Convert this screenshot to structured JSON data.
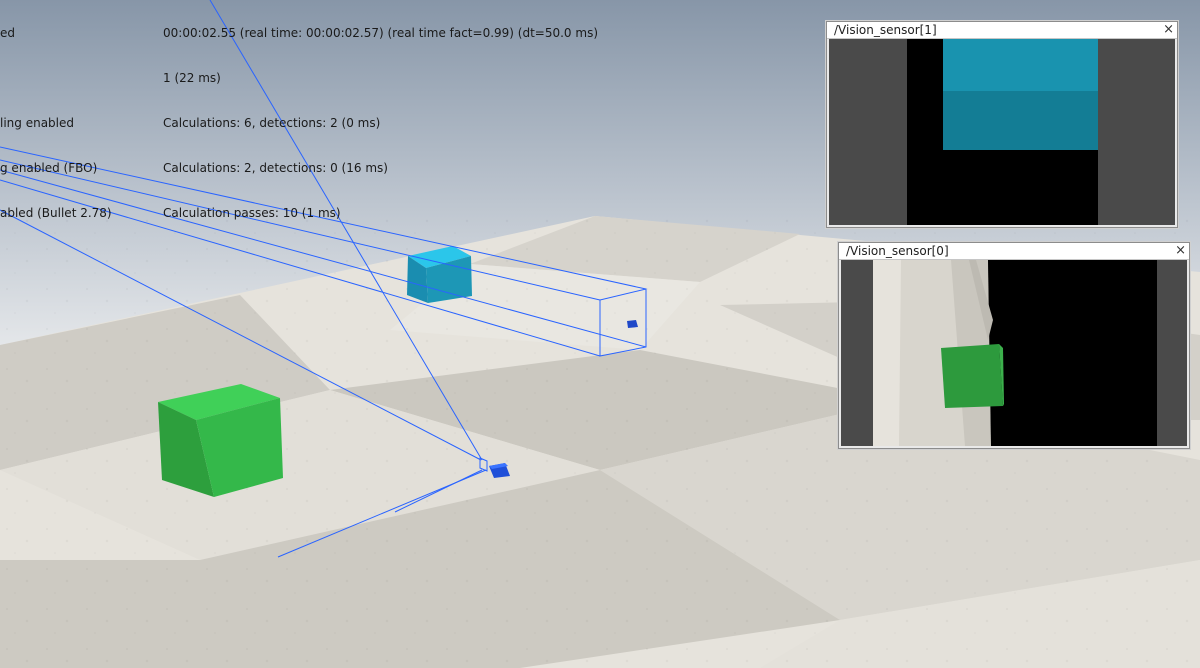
{
  "status_overlay": {
    "left_lines": [
      "ed",
      "",
      "ling enabled",
      "g enabled (FBO)",
      "abled (Bullet 2.78)"
    ],
    "right_lines": [
      "00:00:02.55 (real time: 00:00:02.57) (real time fact=0.99) (dt=50.0 ms)",
      "1 (22 ms)",
      "Calculations: 6, detections: 2 (0 ms)",
      "Calculations: 2, detections: 0 (16 ms)",
      "Calculation passes: 10 (1 ms)"
    ]
  },
  "vision_sensors": [
    {
      "title": "/Vision_sensor[1]",
      "close_glyph": "×"
    },
    {
      "title": "/Vision_sensor[0]",
      "close_glyph": "×"
    }
  ],
  "scene_objects": {
    "cuboid_blue_color": "#1d97b6",
    "cuboid_green_color": "#34b84a",
    "sensor_frustum_color": "#2a64ff"
  }
}
